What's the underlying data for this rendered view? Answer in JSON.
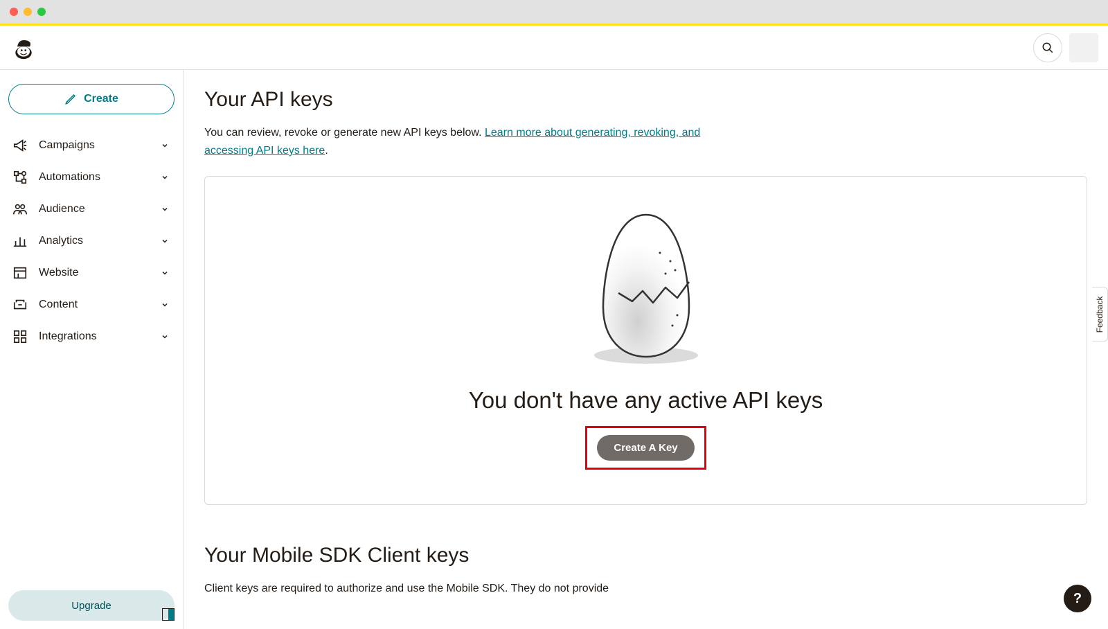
{
  "window": {
    "traffic_light_colors": [
      "#ff5f57",
      "#febc2e",
      "#28c840"
    ]
  },
  "sidebar": {
    "create_label": "Create",
    "items": [
      {
        "label": "Campaigns",
        "icon": "megaphone"
      },
      {
        "label": "Automations",
        "icon": "flow"
      },
      {
        "label": "Audience",
        "icon": "people"
      },
      {
        "label": "Analytics",
        "icon": "bars"
      },
      {
        "label": "Website",
        "icon": "browser"
      },
      {
        "label": "Content",
        "icon": "tray"
      },
      {
        "label": "Integrations",
        "icon": "grid"
      }
    ],
    "upgrade_label": "Upgrade"
  },
  "main": {
    "title": "Your API keys",
    "description_prefix": "You can review, revoke or generate new API keys below. ",
    "description_link": "Learn more about generating, revoking, and accessing API keys here",
    "description_suffix": ".",
    "empty_state_title": "You don't have any active API keys",
    "create_key_label": "Create A Key",
    "sdk_title": "Your Mobile SDK Client keys",
    "sdk_description": "Client keys are required to authorize and use the Mobile SDK. They do not provide"
  },
  "misc": {
    "feedback_label": "Feedback",
    "help_label": "?"
  }
}
